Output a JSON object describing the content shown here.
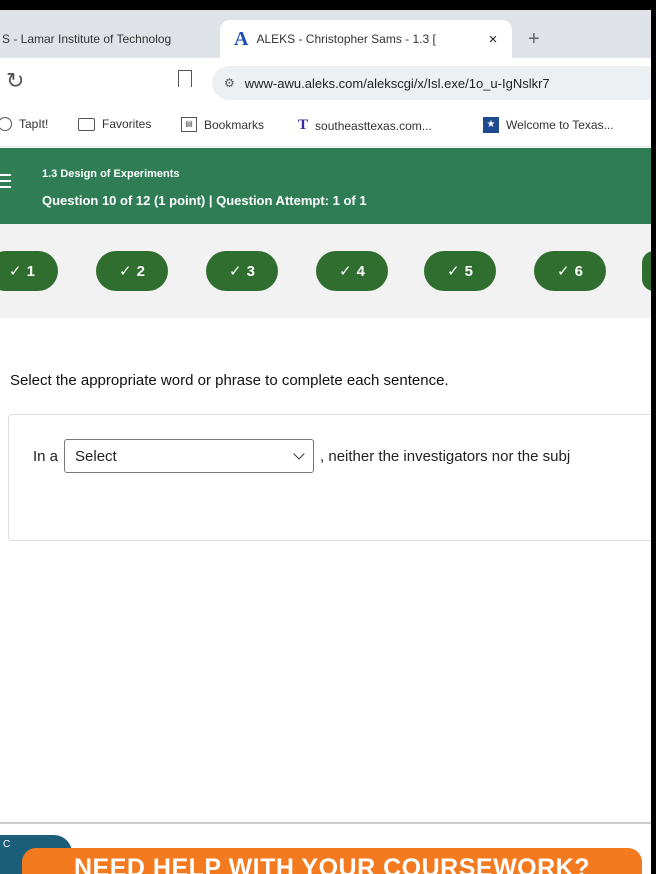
{
  "browser": {
    "tabs": [
      {
        "title": "S - Lamar Institute of Technolog",
        "active": false
      },
      {
        "title": "ALEKS - Christopher Sams - 1.3 [",
        "active": true,
        "logo": "A"
      }
    ],
    "new_tab_glyph": "+",
    "close_glyph": "×",
    "url": "www-awu.aleks.com/alekscgi/x/Isl.exe/1o_u-IgNslkr7",
    "bookmarks": [
      {
        "label": "TapIt!",
        "icon": "tapit-icon"
      },
      {
        "label": "Favorites",
        "icon": "folder-icon"
      },
      {
        "label": "Bookmarks",
        "icon": "bookmarks-icon"
      },
      {
        "label": "southeasttexas.com...",
        "icon": "tp-logo-icon"
      },
      {
        "label": "Welcome to Texas...",
        "icon": "texas-icon"
      }
    ]
  },
  "header": {
    "section": "1.3 Design of Experiments",
    "question_info": "Question 10 of 12 (1 point)  |  Question Attempt: 1 of 1",
    "color": "#2f7d55"
  },
  "progress": {
    "check_glyph": "✓",
    "items": [
      "1",
      "2",
      "3",
      "4",
      "5",
      "6"
    ],
    "pill_color": "#2f6e2f"
  },
  "question": {
    "instructions": "Select the appropriate word or phrase to complete each sentence.",
    "prefix": "In a",
    "select_value": "Select",
    "suffix": ", neither the investigators nor the subj"
  },
  "footer": {
    "chat_label": "C",
    "promo_text": "NEED HELP WITH YOUR COURSEWORK?",
    "promo_color": "#f47a20"
  }
}
